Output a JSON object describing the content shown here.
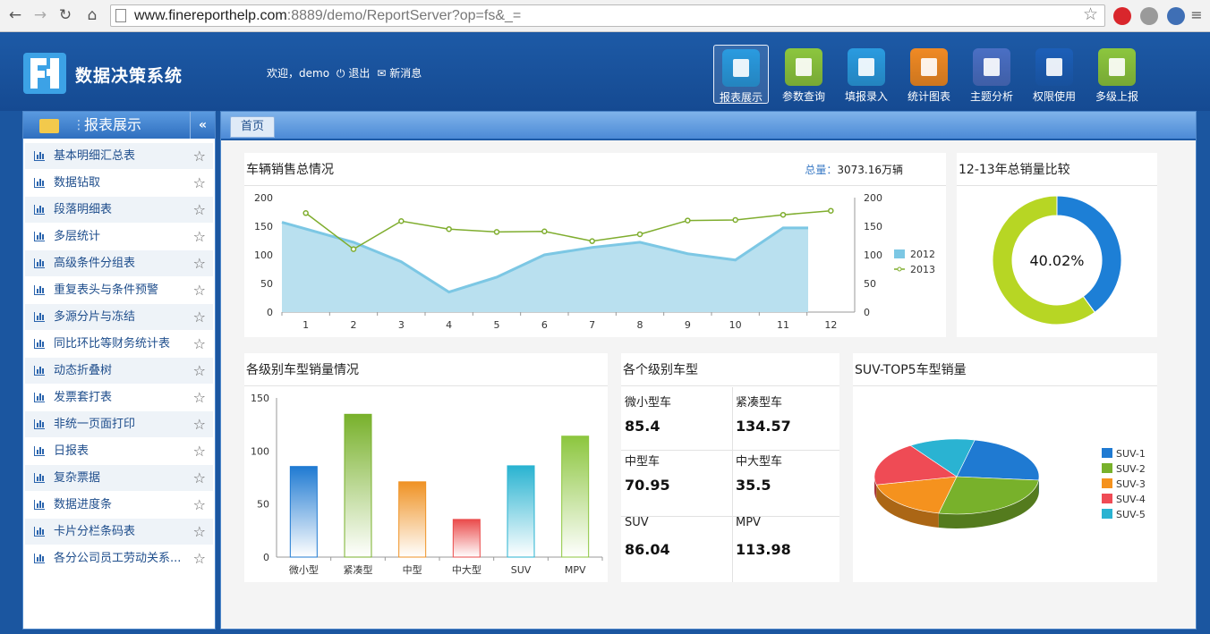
{
  "browser": {
    "url_main": "www.finereporthelp.com",
    "url_rest": ":8889/demo/ReportServer?op=fs&_="
  },
  "app": {
    "title": "数据决策系统",
    "welcome": "欢迎，demo",
    "logout": "退出",
    "messages": "新消息"
  },
  "topnav": [
    {
      "label": "报表展示",
      "icon": "report-icon",
      "color": "#2a9be0"
    },
    {
      "label": "参数查询",
      "icon": "search-icon",
      "color": "#8cc63e"
    },
    {
      "label": "填报录入",
      "icon": "tag-icon",
      "color": "#2a9be0"
    },
    {
      "label": "统计图表",
      "icon": "pie-chart-icon",
      "color": "#f08a24"
    },
    {
      "label": "主题分析",
      "icon": "cross-icon",
      "color": "#4a6fc4"
    },
    {
      "label": "权限使用",
      "icon": "lock-icon",
      "color": "#1c5fb8"
    },
    {
      "label": "多级上报",
      "icon": "hierarchy-icon",
      "color": "#8cc63e"
    }
  ],
  "sidebar": {
    "title": "报表展示",
    "items": [
      "基本明细汇总表",
      "数据钻取",
      "段落明细表",
      "多层统计",
      "高级条件分组表",
      "重复表头与条件预警",
      "多源分片与冻结",
      "同比环比等财务统计表",
      "动态折叠树",
      "发票套打表",
      "非统一页面打印",
      "日报表",
      "复杂票据",
      "数据进度条",
      "卡片分栏条码表",
      "各分公司员工劳动关系..."
    ]
  },
  "tab": {
    "label": "首页"
  },
  "panels": {
    "sales": {
      "title": "车辆销售总情况",
      "total_label": "总量：",
      "total_value": "3073.16万辆"
    },
    "compare": {
      "title": "12-13年总销量比较",
      "center": "40.02%"
    },
    "bylevel": {
      "title": "各级别车型销量情况"
    },
    "metrics": {
      "title": "各个级别车型",
      "items": [
        {
          "label": "微小型车",
          "value": "85.4"
        },
        {
          "label": "紧凑型车",
          "value": "134.57"
        },
        {
          "label": "中型车",
          "value": "70.95"
        },
        {
          "label": "中大型车",
          "value": "35.5"
        },
        {
          "label": "SUV",
          "value": "86.04"
        },
        {
          "label": "MPV",
          "value": "113.98"
        }
      ]
    },
    "suv": {
      "title": "SUV-TOP5车型销量"
    }
  },
  "chart_data": [
    {
      "type": "line",
      "title": "车辆销售总情况",
      "x": [
        1,
        2,
        3,
        4,
        5,
        6,
        7,
        8,
        9,
        10,
        11,
        12
      ],
      "series": [
        {
          "name": "2012",
          "kind": "area",
          "color": "#7cc7e4",
          "values": [
            157,
            122,
            88,
            35,
            61,
            100,
            113,
            122,
            102,
            91,
            147,
            147
          ]
        },
        {
          "name": "2013",
          "kind": "line",
          "color": "#7fad2e",
          "values": [
            173,
            110,
            159,
            145,
            140,
            141,
            124,
            136,
            160,
            161,
            170,
            177
          ]
        }
      ],
      "ylim": [
        0,
        200
      ],
      "yticks": [
        0,
        50,
        100,
        150,
        200
      ]
    },
    {
      "type": "pie",
      "title": "12-13年总销量比较",
      "values": [
        40.02,
        59.98
      ],
      "colors": [
        "#1d7fd6",
        "#b7d624"
      ],
      "center_label": "40.02%"
    },
    {
      "type": "bar",
      "title": "各级别车型销量情况",
      "categories": [
        "微小型",
        "紧凑型",
        "中型",
        "中大型",
        "SUV",
        "MPV"
      ],
      "values": [
        85.4,
        134.57,
        70.95,
        35.5,
        86.04,
        113.98
      ],
      "colors": [
        "#1f7ad2",
        "#78b12b",
        "#ef9224",
        "#ea4b4b",
        "#29b3d1",
        "#8cc63e"
      ],
      "ylim": [
        0,
        150
      ],
      "yticks": [
        0,
        50,
        100,
        150
      ]
    },
    {
      "type": "pie",
      "title": "SUV-TOP5车型销量",
      "categories": [
        "SUV-1",
        "SUV-2",
        "SUV-3",
        "SUV-4",
        "SUV-5"
      ],
      "values": [
        23,
        27,
        18,
        19,
        13
      ],
      "colors": [
        "#1f7ad2",
        "#78b12b",
        "#f5921e",
        "#ef4b55",
        "#2ab3d2"
      ],
      "legend": "right"
    }
  ]
}
